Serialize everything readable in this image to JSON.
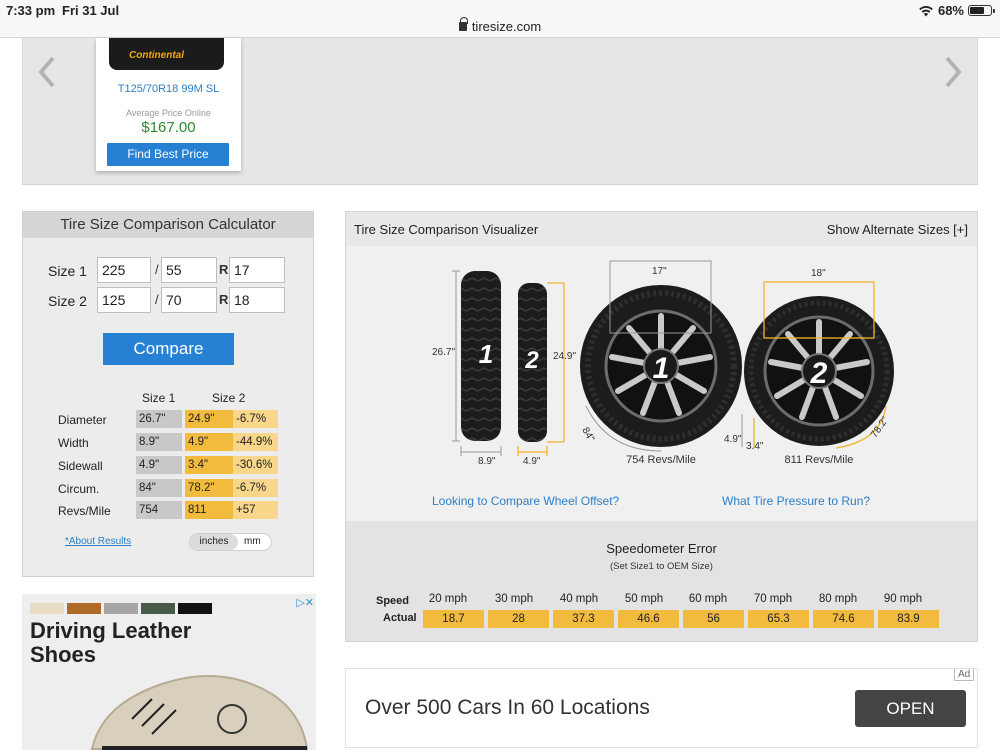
{
  "status_bar": {
    "time": "7:33 pm",
    "date": "Fri 31 Jul",
    "url": "tiresize.com",
    "battery": "68%",
    "battery_level": 0.68
  },
  "carousel": {
    "tire_brand": "Continental",
    "model": "T125/70R18 99M SL",
    "avg_label": "Average Price Online",
    "price": "$167.00",
    "button": "Find Best Price"
  },
  "calculator": {
    "title": "Tire Size Comparison Calculator",
    "size1": {
      "label": "Size 1",
      "width": "225",
      "ratio": "55",
      "rim": "17"
    },
    "size2": {
      "label": "Size 2",
      "width": "125",
      "ratio": "70",
      "rim": "18"
    },
    "slash": "/",
    "r": "R",
    "compare_button": "Compare",
    "col_size1": "Size 1",
    "col_size2": "Size 2",
    "rows": [
      {
        "label": "Diameter",
        "s1": "26.7\"",
        "s2": "24.9\"",
        "diff": "-6.7%"
      },
      {
        "label": "Width",
        "s1": "8.9\"",
        "s2": "4.9\"",
        "diff": "-44.9%"
      },
      {
        "label": "Sidewall",
        "s1": "4.9\"",
        "s2": "3.4\"",
        "diff": "-30.6%"
      },
      {
        "label": "Circum.",
        "s1": "84\"",
        "s2": "78.2\"",
        "diff": "-6.7%"
      },
      {
        "label": "Revs/Mile",
        "s1": "754",
        "s2": "811",
        "diff": "+57"
      }
    ],
    "about_link": "*About Results",
    "unit_inches": "inches",
    "unit_mm": "mm"
  },
  "visualizer": {
    "title": "Tire Size Comparison Visualizer",
    "alt_sizes": "Show Alternate Sizes [+]",
    "labels": {
      "tire1_height": "26.7\"",
      "tire2_height": "24.9\"",
      "tire1_width": "8.9\"",
      "tire2_width": "4.9\"",
      "wheel1_rim": "17\"",
      "wheel2_rim": "18\"",
      "wheel1_circ": "84\"",
      "wheel2_circ": "78.2\"",
      "wheel1_sidewall": "4.9\"",
      "wheel2_sidewall": "3.4\"",
      "wheel1_revs": "754 Revs/Mile",
      "wheel2_revs": "811 Revs/Mile",
      "num1": "1",
      "num2": "2"
    },
    "link_offset": "Looking to Compare Wheel Offset?",
    "link_pressure": "What Tire Pressure to Run?"
  },
  "speedometer": {
    "title": "Speedometer Error",
    "subtitle": "(Set Size1 to OEM Size)",
    "speed_label": "Speed",
    "actual_label": "Actual",
    "speeds": [
      "20 mph",
      "30 mph",
      "40 mph",
      "50 mph",
      "60 mph",
      "70 mph",
      "80 mph",
      "90 mph"
    ],
    "actuals": [
      "18.7",
      "28",
      "37.3",
      "46.6",
      "56",
      "65.3",
      "74.6",
      "83.9"
    ]
  },
  "ad_left": {
    "title_line1": "Driving Leather",
    "title_line2": "Shoes",
    "badge": "▷✕"
  },
  "ad_right": {
    "text": "Over 500 Cars In 60 Locations",
    "button": "OPEN",
    "badge": "Ad"
  },
  "colors": {
    "accent_blue": "#2681d4",
    "highlight_orange": "#f3bb3d",
    "price_green": "#2a8a2a"
  }
}
